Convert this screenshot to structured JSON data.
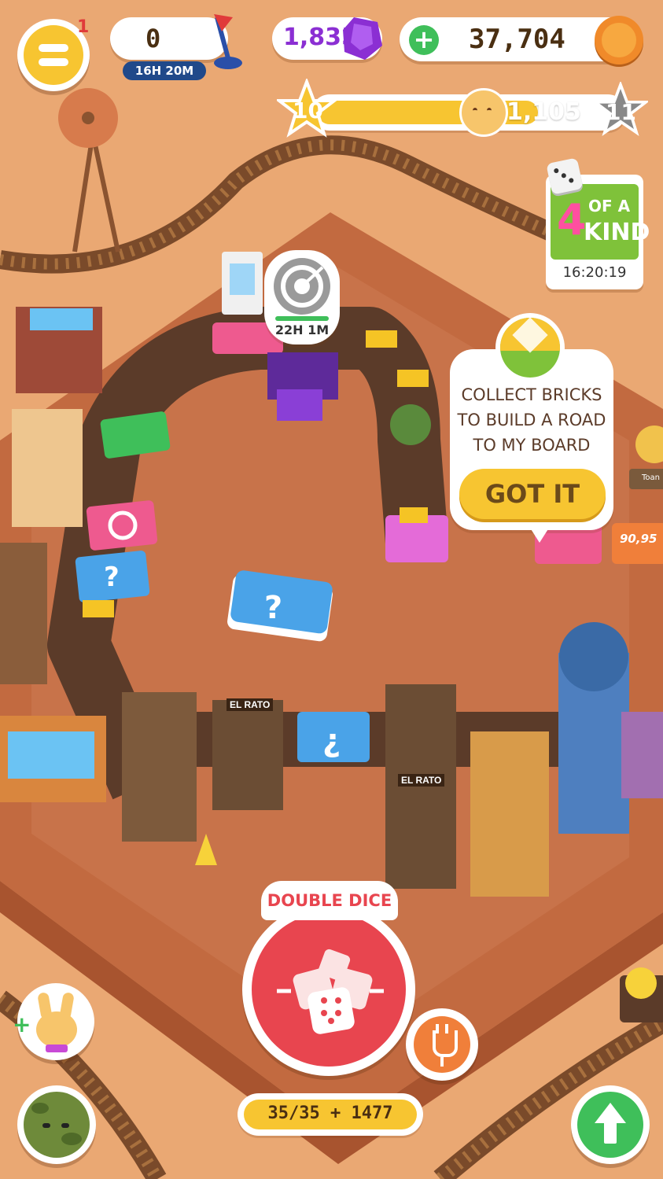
{
  "hud": {
    "menu_badge": "1",
    "pin_count": "0",
    "pin_timer": "16H 20M",
    "gems": "1,835",
    "coins": "37,704",
    "level_current": "10",
    "level_next": "11",
    "xp_value": "1,105",
    "xp_progress": 0.73
  },
  "event": {
    "title_num": "4",
    "title_text_1": "OF A",
    "title_text_2": "KIND",
    "timer": "16:20:19"
  },
  "target_timer": "22H 1M",
  "tooltip": {
    "line1": "COLLECT BRICKS",
    "line2": "TO BUILD A ROAD",
    "line3": "TO MY BOARD",
    "button": "GOT IT"
  },
  "board": {
    "sign_left": "EL RATO",
    "sign_center": "EL RATO",
    "price_tag": "90,95",
    "side_name": "Toan"
  },
  "roll": {
    "title": "DOUBLE DICE",
    "dice_count": "35/35 + 1477"
  },
  "colors": {
    "accent_yellow": "#f7c531",
    "roll_red": "#e8454f",
    "gem_purple": "#8b2fd3",
    "green": "#3fbf5a",
    "board_dark": "#5b3b29"
  },
  "icons": [
    "menu-icon",
    "pin-icon",
    "gem-icon",
    "plus-icon",
    "coin-icon",
    "star-icon",
    "bunny-face-icon",
    "dice-icon",
    "target-icon",
    "brick-icon",
    "plug-icon",
    "arrow-up-icon",
    "bunny-avatar-icon",
    "cactus-avatar-icon"
  ]
}
